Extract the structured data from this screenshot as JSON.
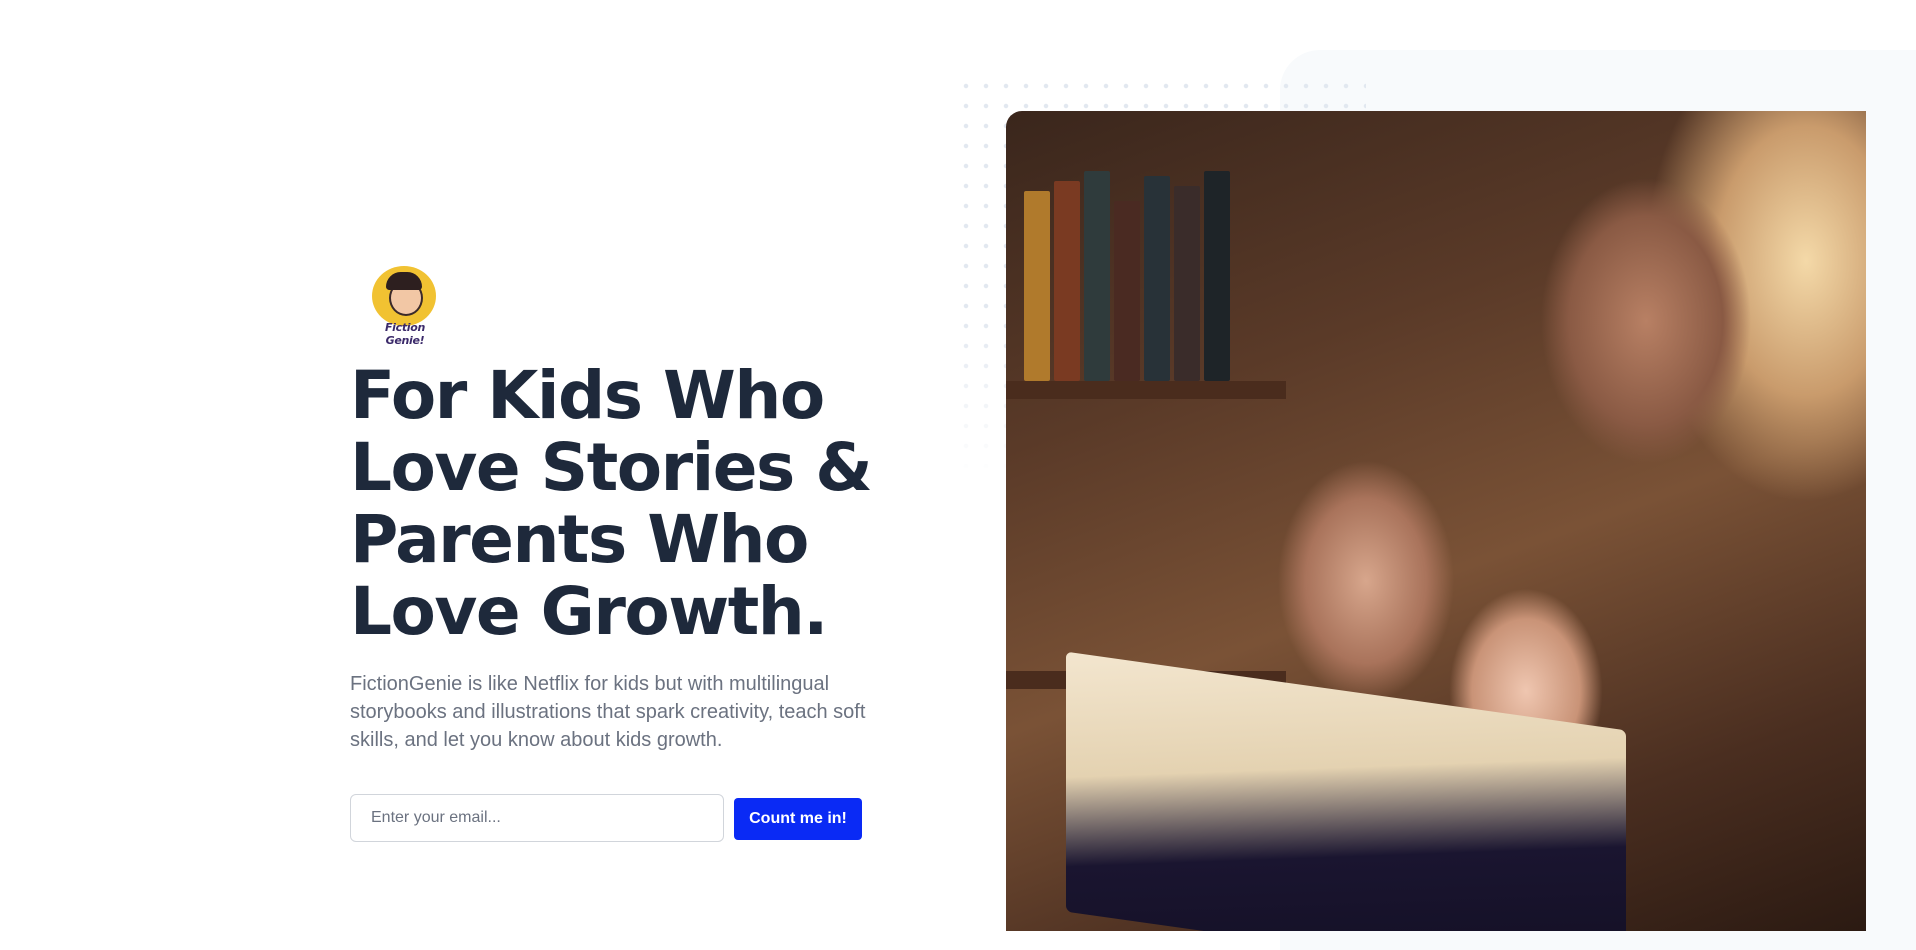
{
  "brand": {
    "logo_text": "Fiction Genie!"
  },
  "hero": {
    "headline_lines": [
      "For Kids Who",
      "Love Stories &",
      "Parents Who",
      "Love Growth."
    ],
    "description": "FictionGenie is like Netflix for kids but with multilingual storybooks and illustrations that spark creativity, teach soft skills, and let you know about kids growth."
  },
  "signup": {
    "email_placeholder": "Enter your email...",
    "email_value": "",
    "button_label": "Count me in!"
  },
  "image": {
    "subject": "illustration-family-reading-book"
  },
  "colors": {
    "headline": "#1e293b",
    "body_text": "#6b7280",
    "button_bg": "#0a2af5",
    "button_text": "#ffffff",
    "panel_bg": "#f8fafc"
  }
}
